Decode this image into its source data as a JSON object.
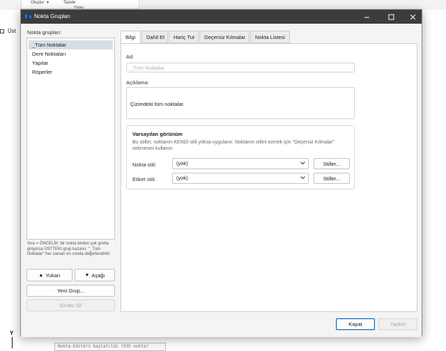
{
  "background_app": {
    "ribbon_items": [
      "Oluştur",
      "Tazele",
      "Yüzey"
    ],
    "left_label": "Üst",
    "command_line": "Nokta Editörü başlatıldı (935 nokta)",
    "axis_label": "Y"
  },
  "window": {
    "title": "Nokta Grupları",
    "controls": [
      "minimize",
      "maximize",
      "close"
    ]
  },
  "left_pane": {
    "label": "Nokta grupları:",
    "groups": [
      "_Tüm Noktalar",
      "Dere Noktaları",
      "Yapılar",
      "Röperler"
    ],
    "selected_index": 0,
    "priority_note": "Sıra = ÖNCELİK: bir nokta birden çok gruba giriyorsa ÜSTTEKİ grup kazanır. \"_Tüm Noktalar\" her zaman en sonda değerlendirilir.",
    "up_button": "Yukarı",
    "down_button": "Aşağı",
    "up_arrow": "▲",
    "down_arrow": "▼",
    "new_group_button": "Yeni Grup...",
    "delete_group_button": "Grubu Sil"
  },
  "tabs": [
    {
      "label": "Bilgi",
      "active": true
    },
    {
      "label": "Dahil Et",
      "active": false
    },
    {
      "label": "Hariç Tut",
      "active": false
    },
    {
      "label": "Geçersiz Kılmalar",
      "active": false
    },
    {
      "label": "Nokta Listesi",
      "active": false
    }
  ],
  "info": {
    "name_label": "Ad:",
    "name_value": "_Tüm Noktalar",
    "description_label": "Açıklama:",
    "description_value": "Çizimdeki tüm noktalar.",
    "default_appearance": {
      "title": "Varsayılan görünüm",
      "description": "Bu stiller, noktanın KENDİ stili yoksa uygulanır. Noktanın stilini ezmek için \"Geçersiz Kılmalar\" sekmesini kullanın.",
      "point_style_label": "Nokta stili:",
      "point_style_value": "(yok)",
      "label_style_label": "Etiket stili:",
      "label_style_value": "(yok)",
      "styles_button": "Stiller..."
    }
  },
  "footer": {
    "close_button": "Kapat",
    "help_button": "Yardım"
  },
  "colors": {
    "titlebar": "#3c3c3c",
    "selection": "#d6dfe9",
    "accent": "#0067c0"
  }
}
